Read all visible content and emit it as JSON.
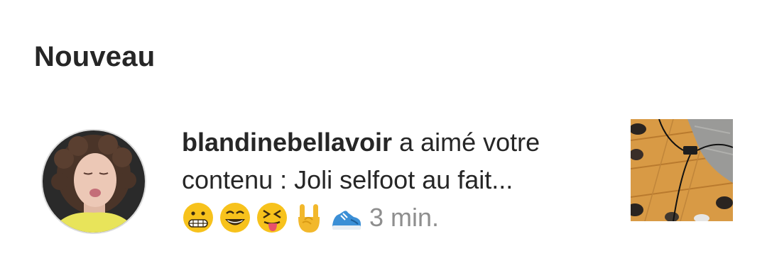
{
  "section": {
    "title": "Nouveau"
  },
  "notification": {
    "username": "blandinebellavoir",
    "message_line1": " a aimé votre",
    "message_line2": "contenu : Joli selfoot au fait...",
    "emojis": [
      "grimacing-face",
      "grinning-face-smiling-eyes",
      "squinting-face-tongue",
      "sign-of-horns-hand",
      "running-shoe"
    ],
    "time": "3 min."
  },
  "colors": {
    "text": "#262626",
    "muted": "#8e8e8e",
    "emoji_yellow": "#F7C21C"
  }
}
